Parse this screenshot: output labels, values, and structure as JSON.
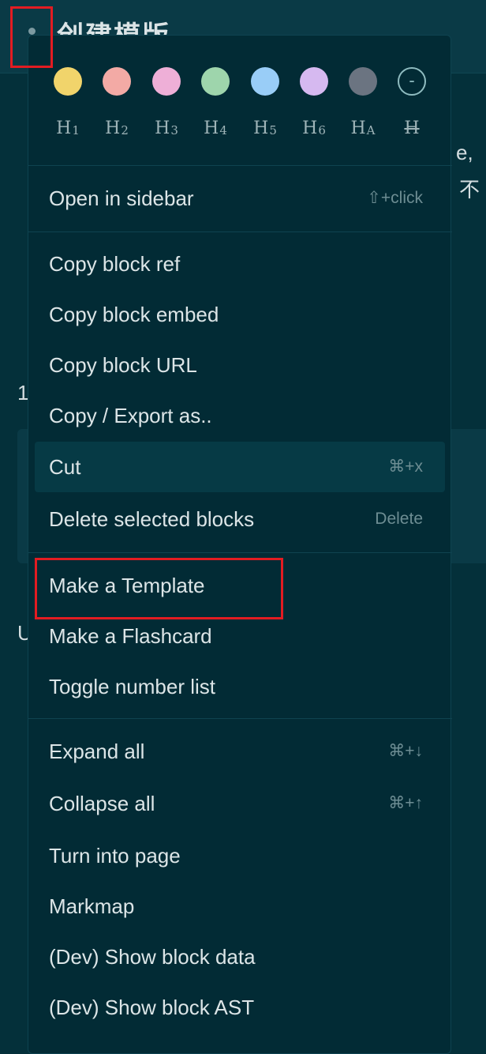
{
  "background": {
    "title": "创建模版",
    "fragments": [
      "e,",
      "不",
      "1",
      "U"
    ]
  },
  "colors": [
    {
      "name": "yellow",
      "hex": "#f1d46b"
    },
    {
      "name": "red",
      "hex": "#f3aaa5"
    },
    {
      "name": "pink",
      "hex": "#eeafd7"
    },
    {
      "name": "green",
      "hex": "#9ed5ac"
    },
    {
      "name": "blue",
      "hex": "#99cdf7"
    },
    {
      "name": "purple",
      "hex": "#d6b9f0"
    },
    {
      "name": "gray",
      "hex": "#6b7481"
    },
    {
      "name": "none",
      "symbol": "-"
    }
  ],
  "headings": [
    {
      "main": "H",
      "sub": "1"
    },
    {
      "main": "H",
      "sub": "2"
    },
    {
      "main": "H",
      "sub": "3"
    },
    {
      "main": "H",
      "sub": "4"
    },
    {
      "main": "H",
      "sub": "5"
    },
    {
      "main": "H",
      "sub": "6"
    },
    {
      "main": "H",
      "sub": "A"
    },
    {
      "main": "H",
      "sub": ""
    }
  ],
  "menu": {
    "open_in_sidebar": {
      "label": "Open in sidebar",
      "shortcut": "⇧+click"
    },
    "copy_block_ref": {
      "label": "Copy block ref"
    },
    "copy_block_embed": {
      "label": "Copy block embed"
    },
    "copy_block_url": {
      "label": "Copy block URL"
    },
    "copy_export": {
      "label": "Copy / Export as.."
    },
    "cut": {
      "label": "Cut",
      "shortcut": "⌘+x"
    },
    "delete_blocks": {
      "label": "Delete selected blocks",
      "shortcut": "Delete"
    },
    "make_template": {
      "label": "Make a Template"
    },
    "make_flashcard": {
      "label": "Make a Flashcard"
    },
    "toggle_number_list": {
      "label": "Toggle number list"
    },
    "expand_all": {
      "label": "Expand all",
      "shortcut": "⌘+↓"
    },
    "collapse_all": {
      "label": "Collapse all",
      "shortcut": "⌘+↑"
    },
    "turn_into_page": {
      "label": "Turn into page"
    },
    "markmap": {
      "label": "Markmap"
    },
    "show_block_data": {
      "label": "(Dev) Show block data"
    },
    "show_block_ast": {
      "label": "(Dev) Show block AST"
    }
  }
}
